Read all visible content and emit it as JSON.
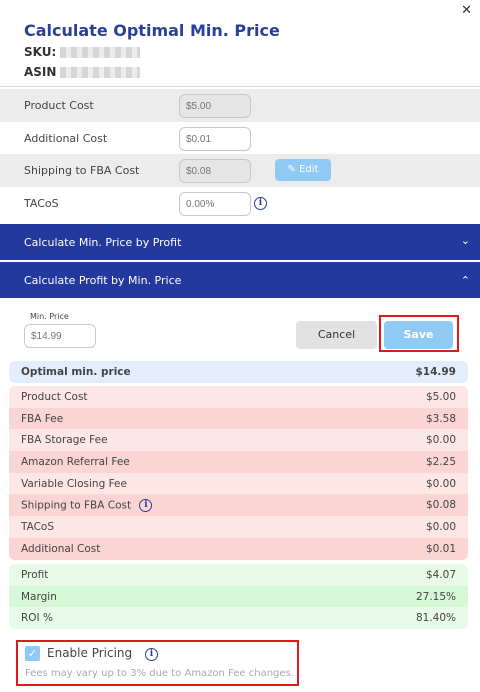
{
  "dialog": {
    "title": "Calculate Optimal Min. Price",
    "sku_label": "SKU:",
    "asin_label": "ASIN"
  },
  "costs": [
    {
      "label": "Product Cost",
      "placeholder": "$5.00"
    },
    {
      "label": "Additional Cost",
      "placeholder": "$0.01"
    },
    {
      "label": "Shipping to FBA Cost",
      "placeholder": "$0.08"
    },
    {
      "label": "TACoS",
      "placeholder": "0.00%"
    }
  ],
  "edit_label": "Edit",
  "accordions": {
    "by_profit": "Calculate Min. Price by Profit",
    "by_min_price": "Calculate Profit by Min. Price"
  },
  "min_price": {
    "label": "Min. Price",
    "placeholder": "$14.99"
  },
  "buttons": {
    "cancel": "Cancel",
    "save": "Save"
  },
  "optimal": {
    "label": "Optimal min. price",
    "value": "$14.99"
  },
  "breakdown": [
    {
      "label": "Product Cost",
      "value": "$5.00"
    },
    {
      "label": "FBA Fee",
      "value": "$3.58"
    },
    {
      "label": "FBA Storage Fee",
      "value": "$0.00"
    },
    {
      "label": "Amazon Referral Fee",
      "value": "$2.25"
    },
    {
      "label": "Variable Closing Fee",
      "value": "$0.00"
    },
    {
      "label": "Shipping to FBA Cost",
      "value": "$0.08"
    },
    {
      "label": "TACoS",
      "value": "$0.00"
    },
    {
      "label": "Additional Cost",
      "value": "$0.01"
    }
  ],
  "results": [
    {
      "label": "Profit",
      "value": "$4.07"
    },
    {
      "label": "Margin",
      "value": "27.15%"
    },
    {
      "label": "ROI %",
      "value": "81.40%"
    }
  ],
  "pricing": {
    "enable_label": "Enable Pricing",
    "note": "Fees may vary up to 3% due to Amazon Fee changes."
  }
}
